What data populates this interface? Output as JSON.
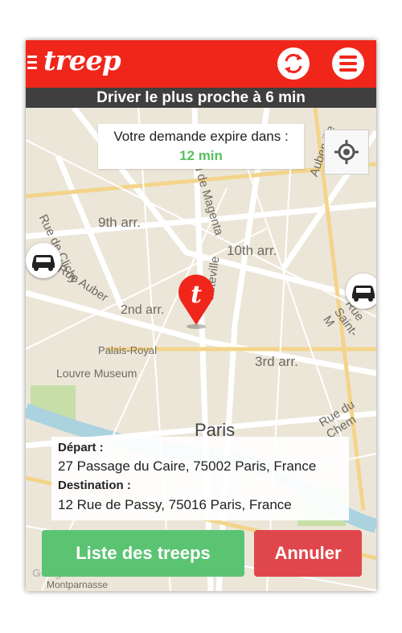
{
  "app": {
    "logo": "treep",
    "logo_color": "#f0261b"
  },
  "header": {
    "refresh_icon": "swap-arrows-icon",
    "menu_icon": "hamburger-menu-icon"
  },
  "status": {
    "text": "Driver le plus proche à 6 min"
  },
  "expire": {
    "label": "Votre demande expire dans :",
    "time": "12 min",
    "time_color": "#57c15f"
  },
  "map": {
    "labels": {
      "rue_de_clichy": "Rue de Clichy",
      "arr9": "9th arr.",
      "arr10": "10th arr.",
      "rue_auber": "Rue Auber",
      "arr2": "2nd arr.",
      "palais_royal": "Palais-Royal",
      "louvre": "Louvre Museum",
      "arr3": "3rd arr.",
      "paris": "Paris",
      "rue_du_chemin": "Rue du Chem",
      "rue_saint_maur": "Rue Saint-M",
      "rue_magenta": "d de Magenta",
      "hauteville": "auteville",
      "aubervilliers": "Auberville",
      "montparnasse": "Montparnasse",
      "google": "Google"
    }
  },
  "pickup": {
    "depart_label": "Départ :",
    "depart_value": "27 Passage du Caire, 75002 Paris, France",
    "destination_label": "Destination :",
    "destination_value": "12 Rue de Passy, 75016 Paris, France"
  },
  "buttons": {
    "list": "Liste des treeps",
    "cancel": "Annuler",
    "list_color": "#5bc473",
    "cancel_color": "#e0474c"
  }
}
